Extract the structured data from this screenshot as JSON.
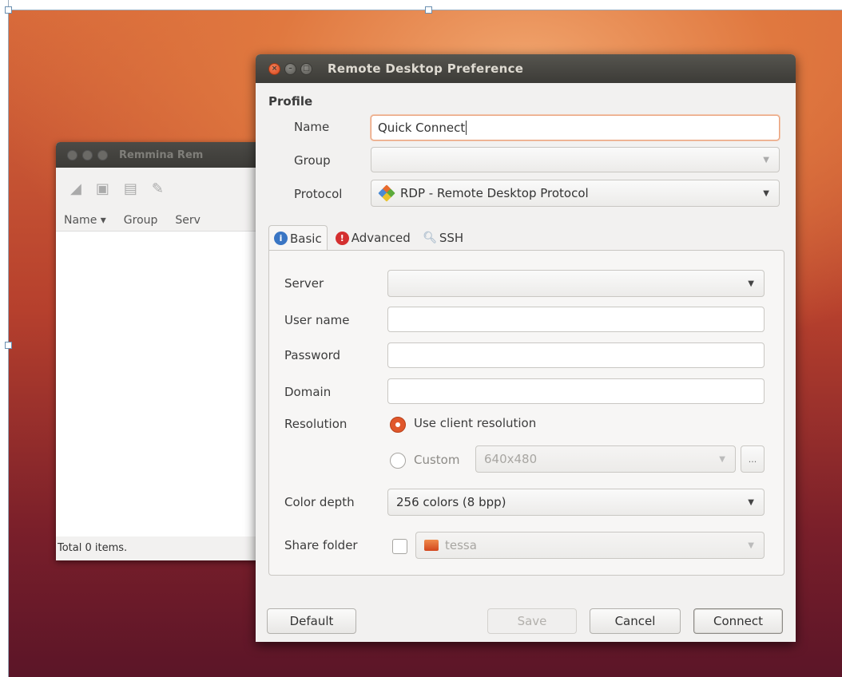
{
  "back_window": {
    "title": "Remmina Rem",
    "columns": [
      "Name ▾",
      "Group",
      "Serv"
    ],
    "status": "Total 0 items."
  },
  "dialog": {
    "title": "Remote Desktop Preference",
    "profile_heading": "Profile",
    "name_label": "Name",
    "name_value": "Quick Connect",
    "group_label": "Group",
    "group_value": "",
    "protocol_label": "Protocol",
    "protocol_value": "RDP - Remote Desktop Protocol",
    "tabs": [
      {
        "label": "Basic",
        "icon": "info-icon"
      },
      {
        "label": "Advanced",
        "icon": "warning-icon"
      },
      {
        "label": "SSH",
        "icon": "ssh-icon"
      }
    ],
    "basic": {
      "server_label": "Server",
      "server_value": "",
      "username_label": "User name",
      "username_value": "",
      "password_label": "Password",
      "password_value": "",
      "domain_label": "Domain",
      "domain_value": "",
      "resolution_label": "Resolution",
      "resolution_option_client": "Use client resolution",
      "resolution_option_custom": "Custom",
      "custom_resolution_value": "640x480",
      "custom_button": "...",
      "color_depth_label": "Color depth",
      "color_depth_value": "256 colors (8 bpp)",
      "share_folder_label": "Share folder",
      "share_folder_value": "tessa"
    },
    "buttons": {
      "default": "Default",
      "save": "Save",
      "cancel": "Cancel",
      "connect": "Connect"
    }
  },
  "colors": {
    "accent": "#e0572b",
    "titlebar": "#3c3b37",
    "info_tab_icon": "#3a76c4",
    "warning_tab_icon": "#d42f2f"
  }
}
